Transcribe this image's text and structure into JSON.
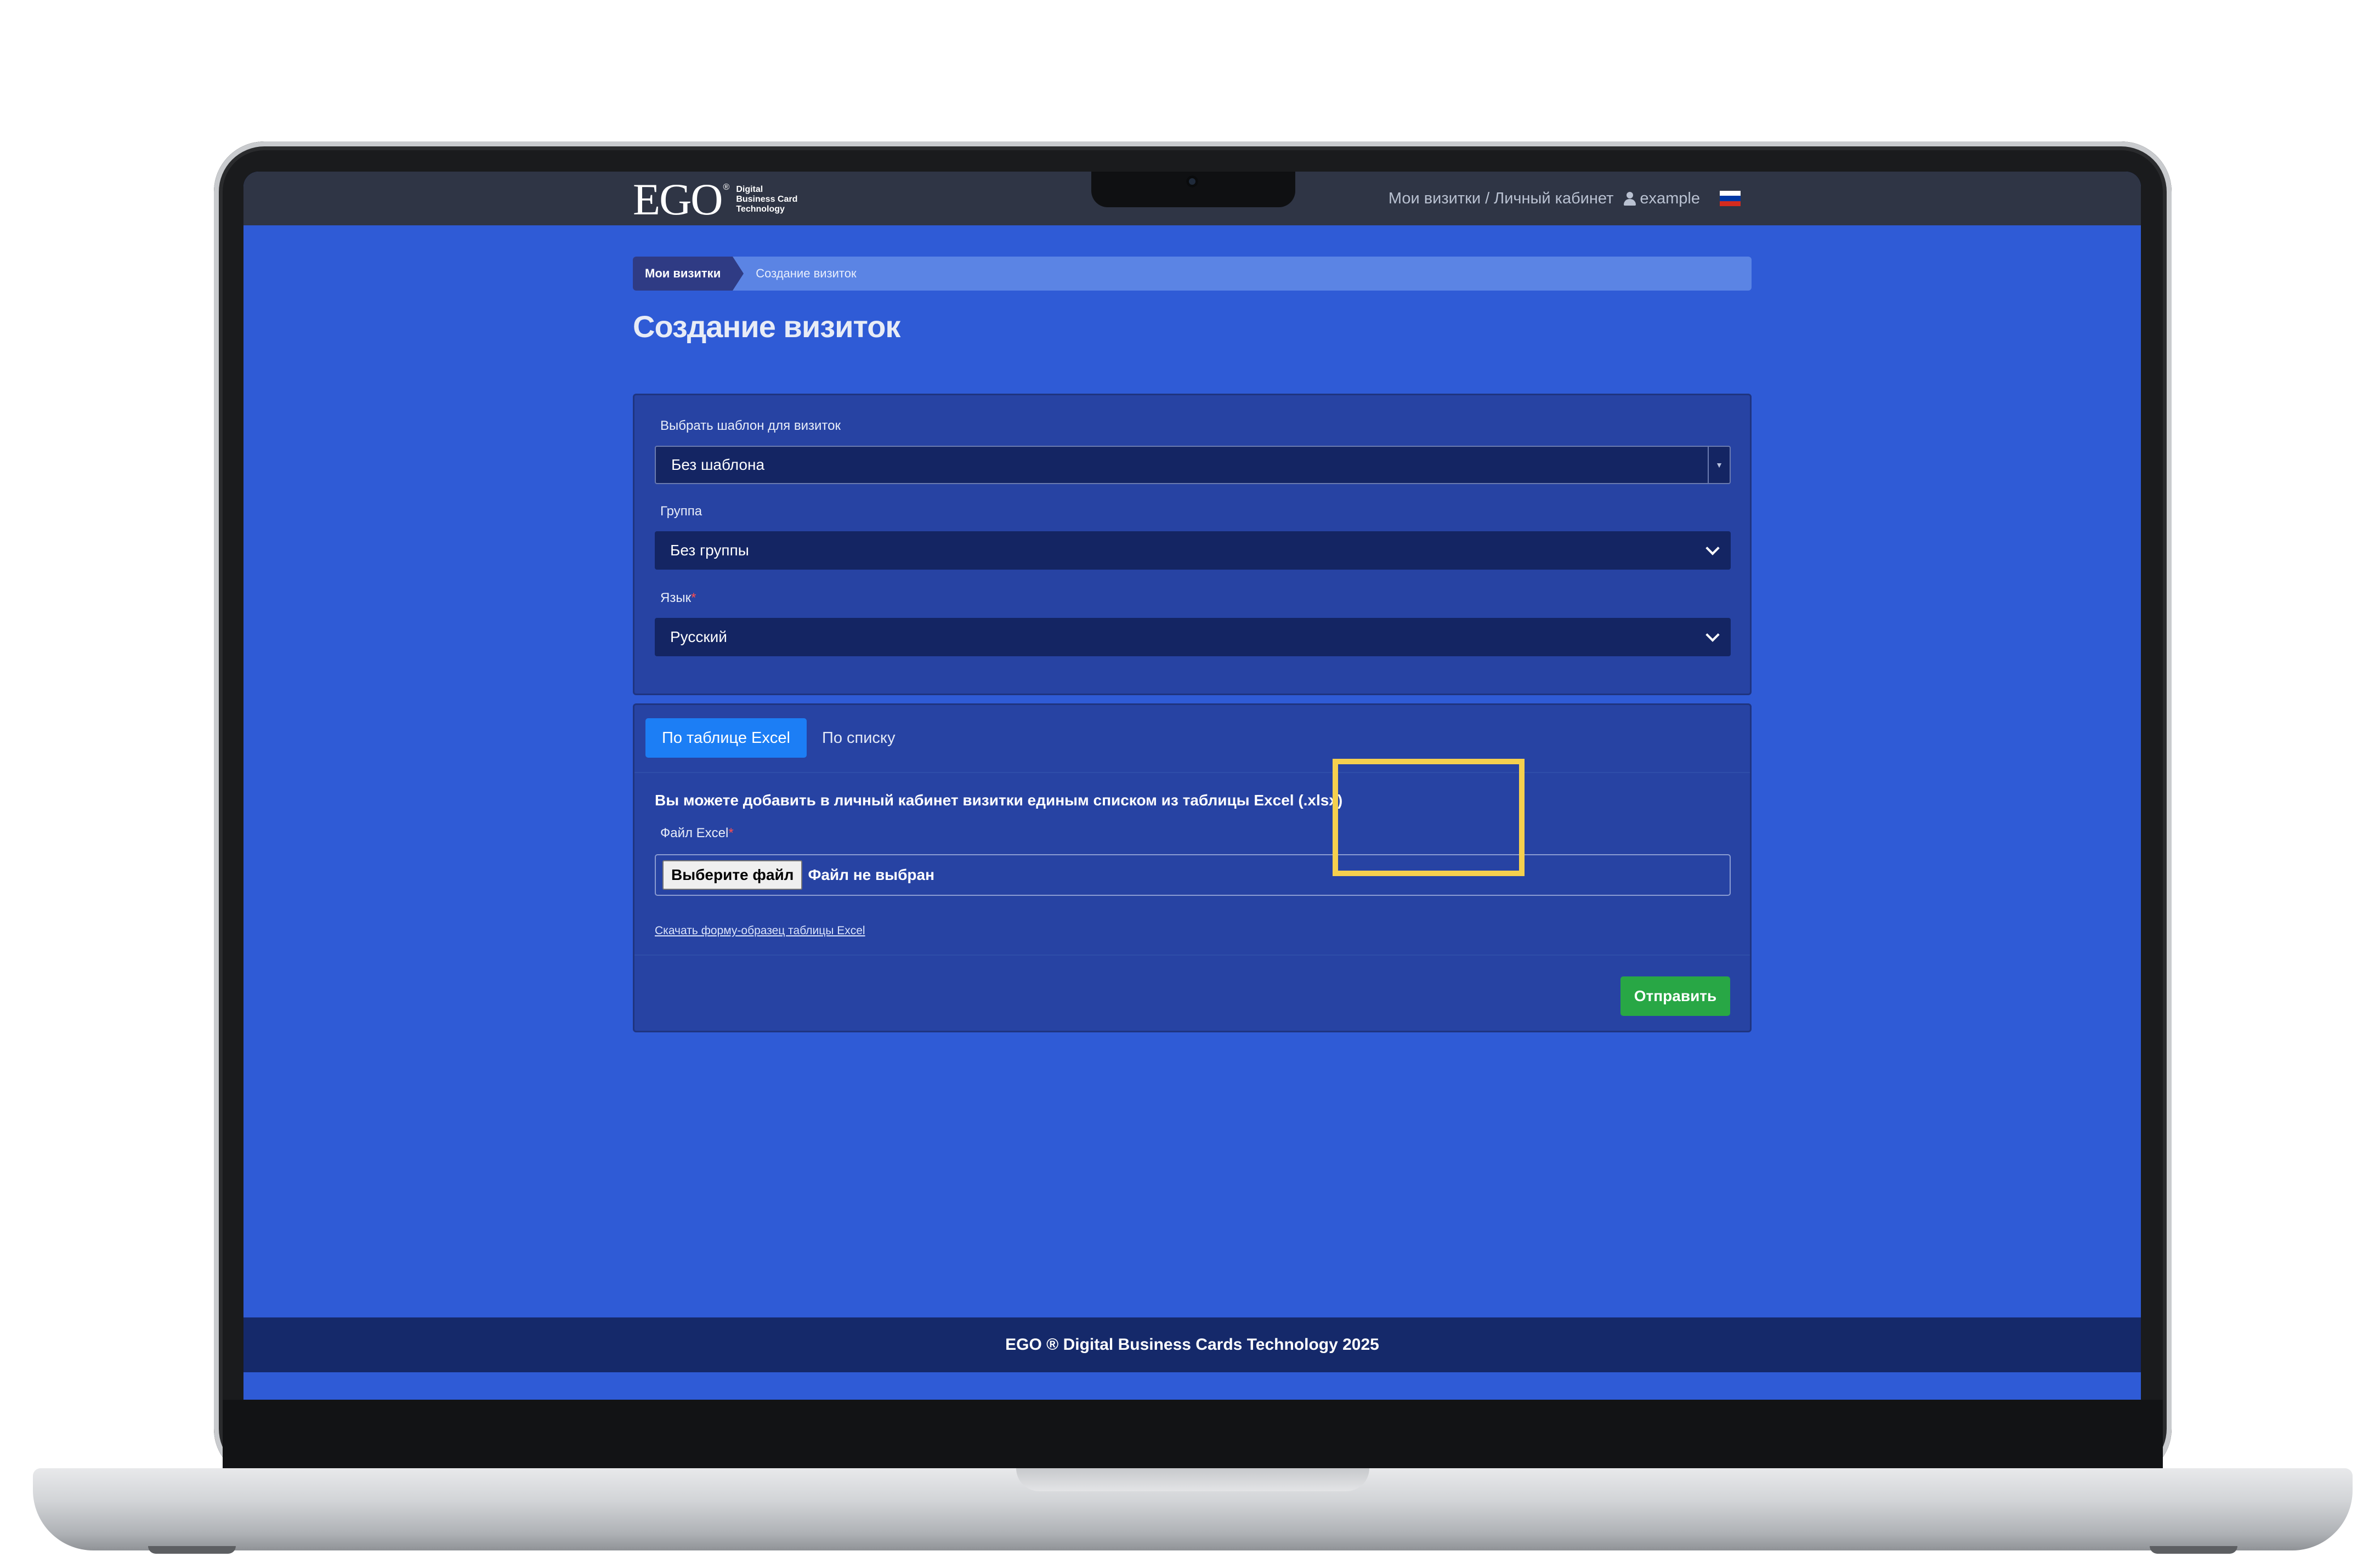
{
  "header": {
    "logo_text": "EGO",
    "logo_registered": "®",
    "logo_tagline": [
      "Digital",
      "Business Card",
      "Technology"
    ],
    "nav_text": "Мои визитки / Личный кабинет",
    "username": "example",
    "language_flag_colors": [
      "#ffffff",
      "#0039a6",
      "#d52b1e"
    ]
  },
  "breadcrumb": {
    "parent": "Мои визитки",
    "current": "Создание визиток"
  },
  "page_title": "Создание визиток",
  "settings": {
    "template_label": "Выбрать шаблон для визиток",
    "template_value": "Без шаблона",
    "group_label": "Группа",
    "group_value": "Без группы",
    "language_label": "Язык",
    "language_value": "Русский",
    "required_mark": "*"
  },
  "tabs": {
    "excel": "По таблице Excel",
    "list": "По списку"
  },
  "excel_form": {
    "description": "Вы можете добавить в личный кабинет визитки единым списком из таблицы Excel (.xlsx)",
    "file_label": "Файл Excel",
    "choose_file": "Выберите файл",
    "no_file": "Файл не выбран",
    "download_link": "Скачать форму-образец таблицы Excel",
    "submit": "Отправить"
  },
  "footer": {
    "text": "EGO ® Digital Business Cards Technology 2025"
  },
  "colors": {
    "page_background": "#2f5bd6",
    "card_background": "#2743a3",
    "active_tab": "#1c7ef5",
    "submit_button": "#28a745",
    "highlight": "#f5d04e"
  }
}
